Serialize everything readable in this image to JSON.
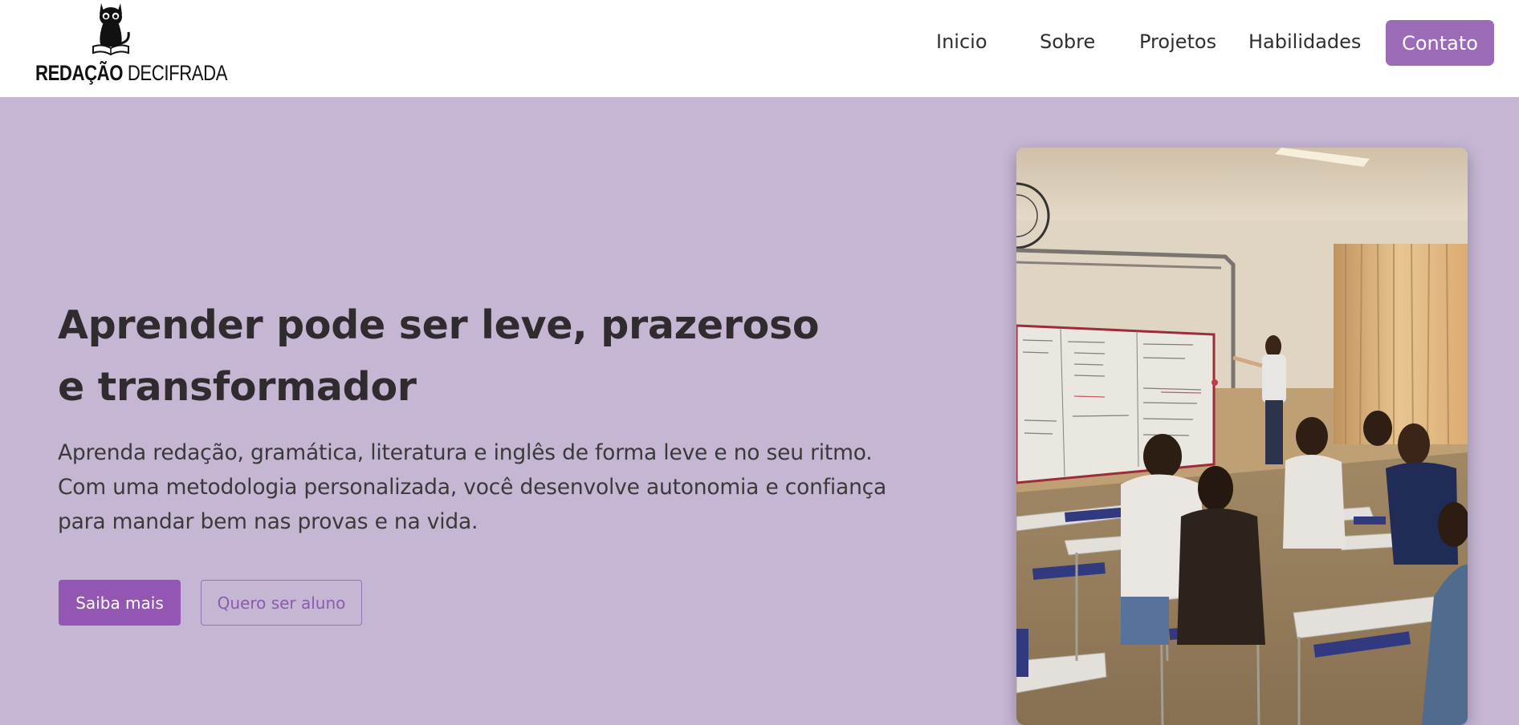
{
  "logo": {
    "text_bold": "REDAÇÃO",
    "text_thin": "DECIFRADA",
    "icon": "cat-reading-book-icon"
  },
  "nav": {
    "items": [
      {
        "label": "Inicio"
      },
      {
        "label": "Sobre"
      },
      {
        "label": "Projetos"
      },
      {
        "label": "Habilidades"
      }
    ],
    "contact_label": "Contato"
  },
  "hero": {
    "title_lines": [
      "Aprender pode ser leve, prazeroso",
      "e transformador"
    ],
    "subtitle_lines": [
      "Aprenda redação, gramática, literatura e inglês de forma leve e no seu ritmo.",
      "Com uma metodologia personalizada, você desenvolve autonomia e confiança",
      "para mandar bem nas provas e na vida."
    ],
    "primary_button": "Saiba mais",
    "secondary_button": "Quero ser aluno",
    "image": "classroom-photo"
  },
  "colors": {
    "page_bg": "#c5b6d3",
    "header_bg": "#ffffff",
    "accent": "#9b6bb8",
    "primary_button": "#9356b3",
    "text_dark": "#2f2b2f"
  }
}
